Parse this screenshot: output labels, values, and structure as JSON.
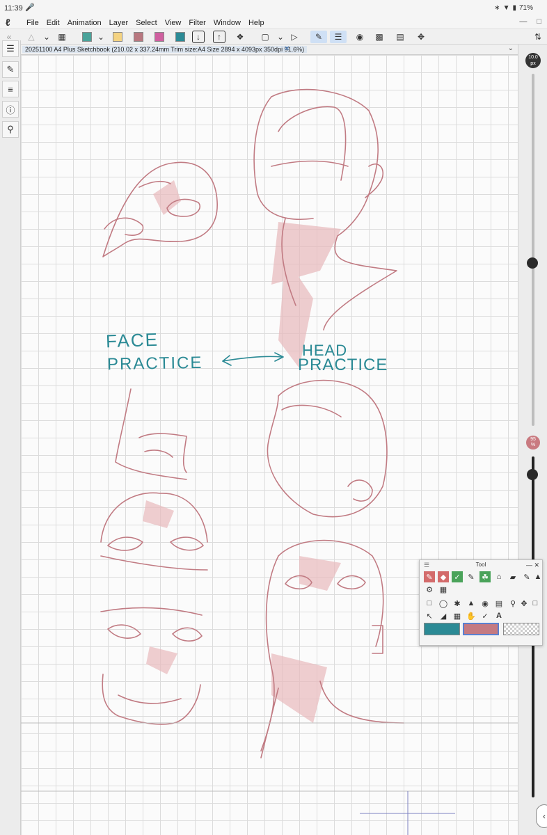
{
  "status": {
    "time": "11:39",
    "battery": "71%"
  },
  "menu": {
    "items": [
      "File",
      "Edit",
      "Animation",
      "Layer",
      "Select",
      "View",
      "Filter",
      "Window",
      "Help"
    ]
  },
  "document": {
    "tab_title": "20251100 A4 Plus Sketchbook (210.02 x 337.24mm Trim size:A4 Size 2894 x 4093px 350dpi 91.6%)"
  },
  "brush": {
    "size_label": "10.0",
    "size_unit": "px",
    "opacity_value": "95",
    "opacity_unit": "%"
  },
  "canvas_text": {
    "face_line1": "FACE",
    "face_line2": "PRACTICE",
    "head_line1": "HEAD",
    "head_line2": "PRACTICE"
  },
  "tool_panel": {
    "title": "Tool"
  },
  "colors": {
    "main": "#2b8a95",
    "sub": "#c47a82",
    "sketch": "#c17b83",
    "swatches": [
      "#4aa39a",
      "#f4d382",
      "#b8777f",
      "#cf5f9f",
      "#2b8a95"
    ]
  },
  "icons": {
    "left_rail": [
      "layers-icon",
      "pen-settings-icon",
      "adjust-icon",
      "info-icon",
      "search-icon"
    ],
    "toolbar": [
      "eraser-icon",
      "selection-icon",
      "swatch-teal",
      "swatch-yellow",
      "swatch-rose",
      "swatch-pink",
      "swatch-blue",
      "import-icon",
      "export-icon",
      "share-icon",
      "transform-icon",
      "flip-icon",
      "pen-tool-icon",
      "layer-tool-icon"
    ]
  }
}
